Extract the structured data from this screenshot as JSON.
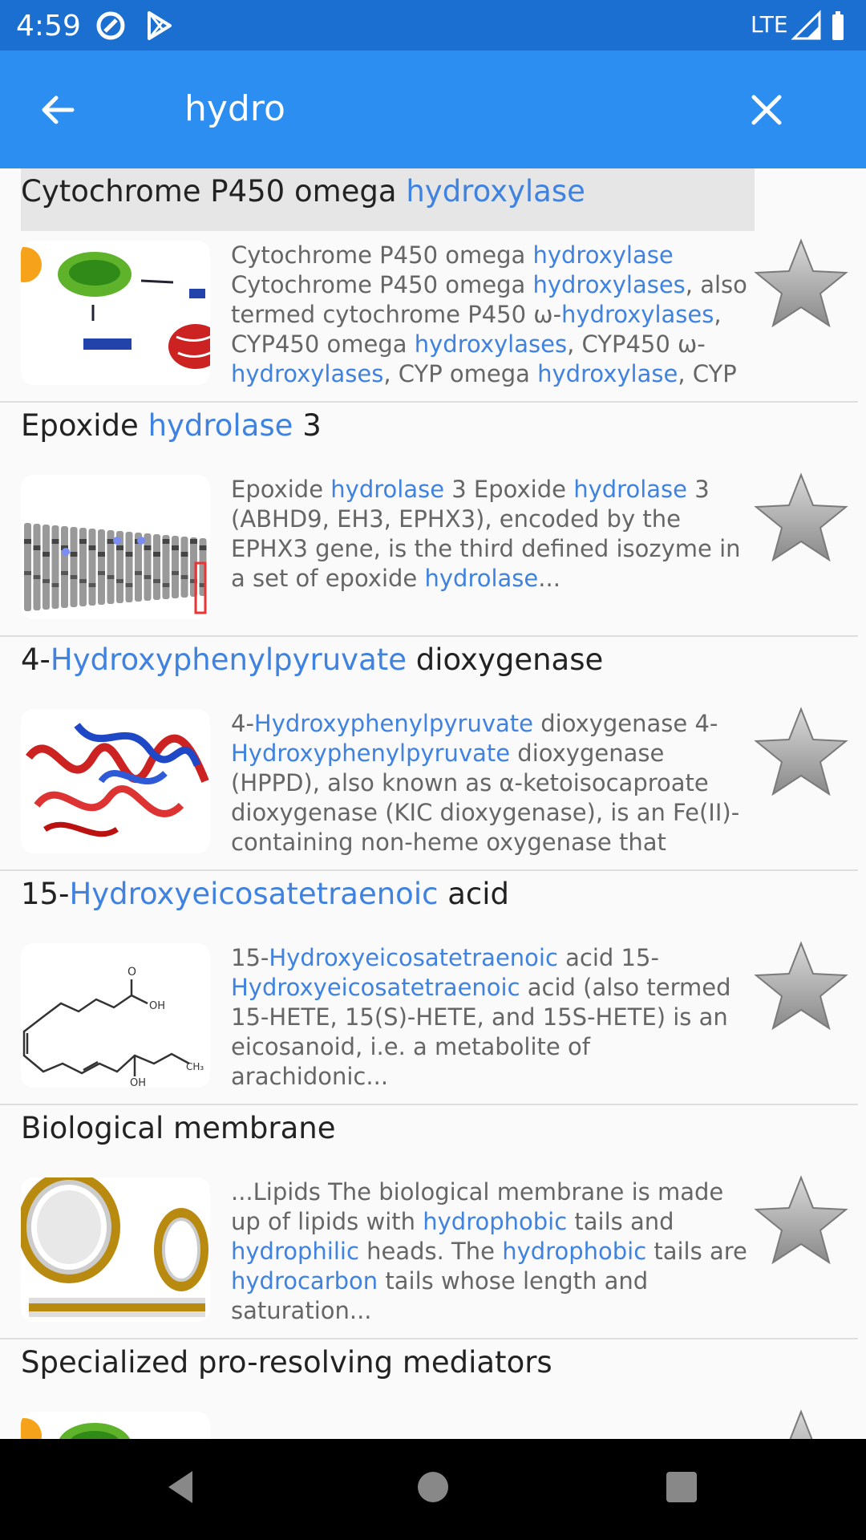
{
  "status": {
    "time": "4:59",
    "network": "LTE"
  },
  "search": {
    "query": "hydro"
  },
  "results": [
    {
      "title": [
        {
          "t": "Cytochrome P450 omega "
        },
        {
          "t": "hydroxylase",
          "h": true
        }
      ],
      "selected": true,
      "thumb": "mitochondria-diagram",
      "snippet": [
        {
          "t": "Cytochrome P450 omega "
        },
        {
          "t": "hydroxylase",
          "h": true
        },
        {
          "t": " Cytochrome P450 omega "
        },
        {
          "t": "hydroxylases",
          "h": true
        },
        {
          "t": ", also termed cytochrome P450 ω-"
        },
        {
          "t": "hydroxylases",
          "h": true
        },
        {
          "t": ", CYP450 omega "
        },
        {
          "t": "hydroxylases",
          "h": true
        },
        {
          "t": ", CYP450 ω-"
        },
        {
          "t": "hydroxylases",
          "h": true
        },
        {
          "t": ", CYP omega "
        },
        {
          "t": "hydroxylase",
          "h": true
        },
        {
          "t": ", CYP ω-"
        }
      ]
    },
    {
      "title": [
        {
          "t": "Epoxide "
        },
        {
          "t": "hydrolase",
          "h": true
        },
        {
          "t": " 3"
        }
      ],
      "thumb": "chromosome-ideogram",
      "snippet": [
        {
          "t": "Epoxide "
        },
        {
          "t": "hydrolase",
          "h": true
        },
        {
          "t": " 3 Epoxide "
        },
        {
          "t": "hydrolase",
          "h": true
        },
        {
          "t": " 3 (ABHD9, EH3, EPHX3), encoded by the EPHX3 gene, is the third defined isozyme in a set of epoxide "
        },
        {
          "t": "hydrolase",
          "h": true
        },
        {
          "t": "..."
        }
      ]
    },
    {
      "title": [
        {
          "t": "4-"
        },
        {
          "t": "Hydroxyphenylpyruvate",
          "h": true
        },
        {
          "t": " dioxygenase"
        }
      ],
      "thumb": "protein-ribbon",
      "snippet": [
        {
          "t": "4-"
        },
        {
          "t": "Hydroxyphenylpyruvate",
          "h": true
        },
        {
          "t": " dioxygenase 4-"
        },
        {
          "t": "Hydroxyphenylpyruvate",
          "h": true
        },
        {
          "t": " dioxygenase (HPPD), also known as α-ketoisocaproate dioxygenase (KIC dioxygenase), is an Fe(II)-containing non-heme oxygenase that catalyzes..."
        }
      ]
    },
    {
      "title": [
        {
          "t": "15-"
        },
        {
          "t": "Hydroxyeicosatetraenoic",
          "h": true
        },
        {
          "t": " acid"
        }
      ],
      "thumb": "chemical-structure",
      "snippet": [
        {
          "t": "15-"
        },
        {
          "t": "Hydroxyeicosatetraenoic",
          "h": true
        },
        {
          "t": " acid 15-"
        },
        {
          "t": "Hydroxyeicosatetraenoic",
          "h": true
        },
        {
          "t": " acid (also termed 15-HETE, 15(S)-HETE, and 15S-HETE) is an eicosanoid, i.e. a metabolite of arachidonic..."
        }
      ]
    },
    {
      "title": [
        {
          "t": "Biological membrane"
        }
      ],
      "thumb": "micelle-diagram",
      "snippet": [
        {
          "t": "...Lipids The biological membrane is made up of lipids with "
        },
        {
          "t": "hydrophobic",
          "h": true
        },
        {
          "t": " tails and "
        },
        {
          "t": "hydrophilic",
          "h": true
        },
        {
          "t": " heads. The "
        },
        {
          "t": "hydrophobic",
          "h": true
        },
        {
          "t": " tails are "
        },
        {
          "t": "hydrocarbon",
          "h": true
        },
        {
          "t": " tails whose length and saturation..."
        }
      ]
    },
    {
      "title": [
        {
          "t": "Specialized pro-resolving mediators"
        }
      ],
      "thumb": "mitochondria-diagram",
      "snippet": []
    }
  ],
  "colors": {
    "status_bar": "#1a6fd1",
    "app_bar": "#2b8ef0",
    "highlight": "#3f82e0"
  }
}
